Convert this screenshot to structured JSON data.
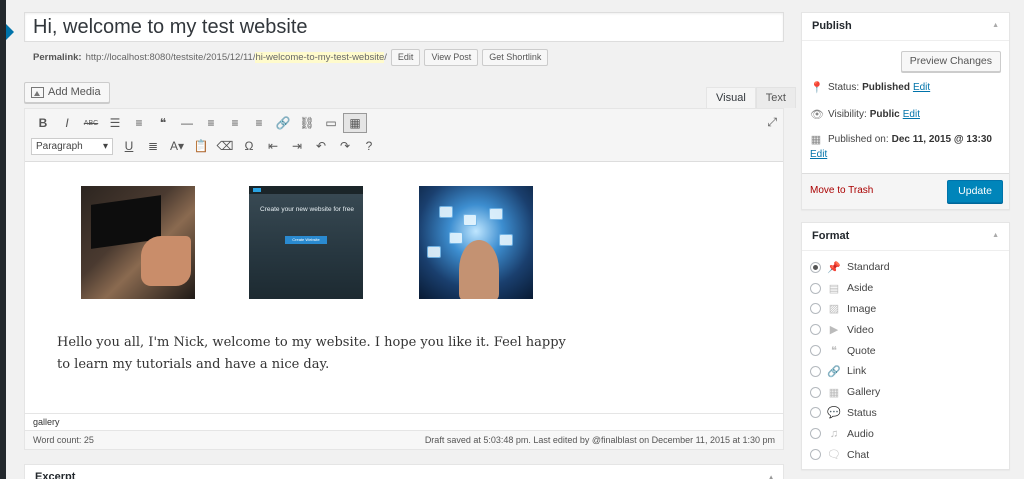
{
  "post": {
    "title": "Hi, welcome to my test website",
    "permalink_label": "Permalink:",
    "permalink_base": "http://localhost:8080/testsite/2015/12/11/",
    "permalink_slug": "hi-welcome-to-my-test-website",
    "permalink_trailing": "/",
    "edit_btn": "Edit",
    "view_btn": "View Post",
    "shortlink_btn": "Get Shortlink"
  },
  "editor": {
    "add_media": "Add Media",
    "tab_visual": "Visual",
    "tab_text": "Text",
    "format_select": "Paragraph",
    "thumb2_text": "Create your new website for free",
    "thumb2_button": "Create Website",
    "paragraph": "Hello you all, I'm Nick, welcome to my website. I hope you like it. Feel happy to learn my tutorials and have a nice day.",
    "path": "gallery",
    "word_count": "Word count: 25",
    "draft_status": "Draft saved at 5:03:48 pm. Last edited by @finalblast on December 11, 2015 at 1:30 pm"
  },
  "toolbar_row1": [
    {
      "name": "bold-icon",
      "glyph": "B"
    },
    {
      "name": "italic-icon",
      "glyph": "I"
    },
    {
      "name": "strikethrough-icon",
      "glyph": "ABC"
    },
    {
      "name": "bullet-list-icon",
      "glyph": "☰"
    },
    {
      "name": "numbered-list-icon",
      "glyph": "≡"
    },
    {
      "name": "blockquote-icon",
      "glyph": "❝"
    },
    {
      "name": "horizontal-line-icon",
      "glyph": "—"
    },
    {
      "name": "align-left-icon",
      "glyph": "≡"
    },
    {
      "name": "align-center-icon",
      "glyph": "≡"
    },
    {
      "name": "align-right-icon",
      "glyph": "≡"
    },
    {
      "name": "insert-link-icon",
      "glyph": "🔗"
    },
    {
      "name": "remove-link-icon",
      "glyph": "⛓"
    },
    {
      "name": "read-more-icon",
      "glyph": "▭"
    },
    {
      "name": "toolbar-toggle-icon",
      "glyph": "▦"
    }
  ],
  "toolbar_row2": [
    {
      "name": "underline-icon",
      "glyph": "U"
    },
    {
      "name": "justify-icon",
      "glyph": "≣"
    },
    {
      "name": "text-color-icon",
      "glyph": "A▾"
    },
    {
      "name": "paste-text-icon",
      "glyph": "📋"
    },
    {
      "name": "clear-formatting-icon",
      "glyph": "⌫"
    },
    {
      "name": "special-character-icon",
      "glyph": "Ω"
    },
    {
      "name": "outdent-icon",
      "glyph": "⇤"
    },
    {
      "name": "indent-icon",
      "glyph": "⇥"
    },
    {
      "name": "undo-icon",
      "glyph": "↶"
    },
    {
      "name": "redo-icon",
      "glyph": "↷"
    },
    {
      "name": "help-icon",
      "glyph": "?"
    }
  ],
  "excerpt": {
    "title": "Excerpt"
  },
  "publish": {
    "title": "Publish",
    "preview_btn": "Preview Changes",
    "status_label": "Status:",
    "status_value": "Published",
    "visibility_label": "Visibility:",
    "visibility_value": "Public",
    "published_label": "Published on:",
    "published_value": "Dec 11, 2015 @ 13:30",
    "edit_link": "Edit",
    "trash": "Move to Trash",
    "update_btn": "Update"
  },
  "format": {
    "title": "Format",
    "options": [
      {
        "label": "Standard",
        "icon": "pin-icon",
        "glyph": "📌",
        "checked": true
      },
      {
        "label": "Aside",
        "icon": "aside-icon",
        "glyph": "▤",
        "checked": false
      },
      {
        "label": "Image",
        "icon": "image-icon",
        "glyph": "▨",
        "checked": false
      },
      {
        "label": "Video",
        "icon": "video-icon",
        "glyph": "▶",
        "checked": false
      },
      {
        "label": "Quote",
        "icon": "quote-icon",
        "glyph": "❝",
        "checked": false
      },
      {
        "label": "Link",
        "icon": "link-icon",
        "glyph": "🔗",
        "checked": false
      },
      {
        "label": "Gallery",
        "icon": "gallery-icon",
        "glyph": "▦",
        "checked": false
      },
      {
        "label": "Status",
        "icon": "status-icon",
        "glyph": "💬",
        "checked": false
      },
      {
        "label": "Audio",
        "icon": "audio-icon",
        "glyph": "♫",
        "checked": false
      },
      {
        "label": "Chat",
        "icon": "chat-icon",
        "glyph": "🗨",
        "checked": false
      }
    ]
  },
  "colors": {
    "accent": "#0073aa",
    "primary_button": "#0085ba",
    "trash": "#a00000",
    "slug_highlight": "#fffbcc"
  }
}
